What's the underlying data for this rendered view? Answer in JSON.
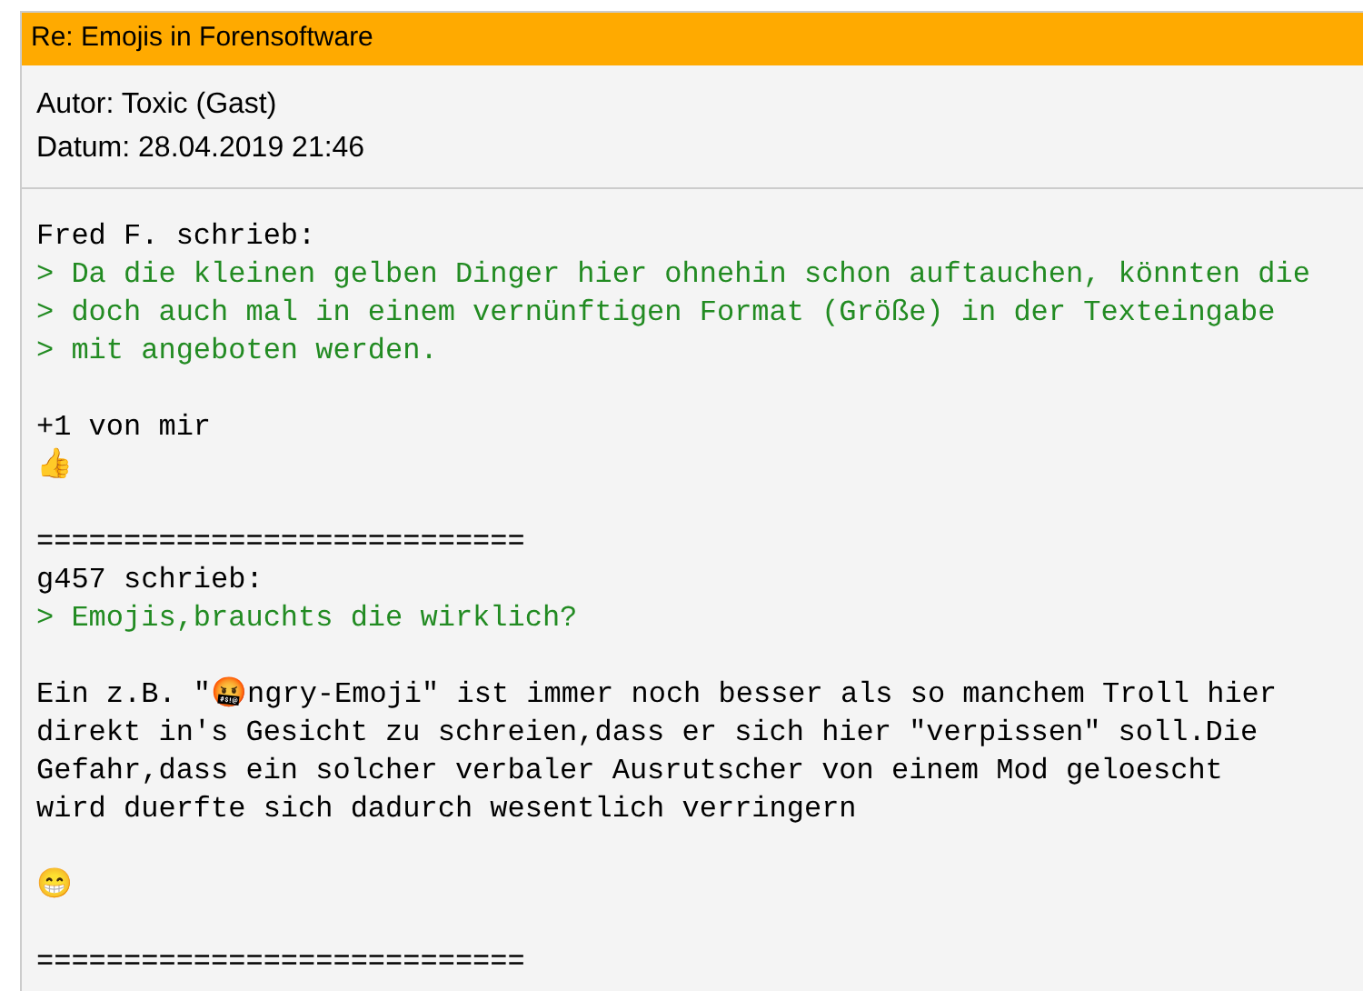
{
  "post": {
    "subject": "Re: Emojis in Forensoftware",
    "meta": [
      "Autor: Toxic (Gast)",
      "Datum: 28.04.2019 21:46"
    ],
    "paragraphs": [
      {
        "lines": [
          {
            "kind": "text",
            "text": "Fred F. schrieb:"
          },
          {
            "kind": "quote",
            "text": "> Da die kleinen gelben Dinger hier ohnehin schon auftauchen, könnten die"
          },
          {
            "kind": "quote",
            "text": "> doch auch mal in einem vernünftigen Format (Größe) in der Texteingabe"
          },
          {
            "kind": "quote",
            "text": "> mit angeboten werden."
          }
        ]
      },
      {
        "lines": [
          {
            "kind": "text",
            "text": "+1 von mir"
          },
          {
            "kind": "text",
            "text": "👍"
          }
        ]
      },
      {
        "lines": [
          {
            "kind": "text",
            "text": "============================"
          },
          {
            "kind": "text",
            "text": "g457 schrieb:"
          },
          {
            "kind": "quote",
            "text": "> Emojis,brauchts die wirklich?"
          }
        ]
      },
      {
        "lines": [
          {
            "kind": "text",
            "text": "Ein z.B. \"🤬ngry-Emoji\" ist immer noch besser als so manchem Troll hier"
          },
          {
            "kind": "text",
            "text": "direkt in's Gesicht zu schreien,dass er sich hier \"verpissen\" soll.Die"
          },
          {
            "kind": "text",
            "text": "Gefahr,dass ein solcher verbaler Ausrutscher von einem Mod geloescht"
          },
          {
            "kind": "text",
            "text": "wird duerfte sich dadurch wesentlich verringern"
          }
        ]
      },
      {
        "lines": [
          {
            "kind": "text",
            "text": "😁"
          }
        ]
      },
      {
        "lines": [
          {
            "kind": "text",
            "text": "============================"
          }
        ]
      }
    ]
  }
}
